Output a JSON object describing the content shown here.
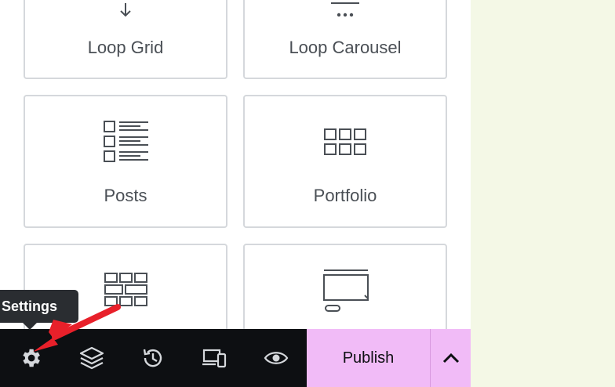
{
  "widgets": [
    {
      "label": "Loop Grid",
      "icon": "loop-grid-icon"
    },
    {
      "label": "Loop Carousel",
      "icon": "loop-carousel-icon"
    },
    {
      "label": "Posts",
      "icon": "posts-icon"
    },
    {
      "label": "Portfolio",
      "icon": "portfolio-icon"
    },
    {
      "label": "",
      "icon": "gallery-icon"
    },
    {
      "label": "",
      "icon": "slides-icon"
    }
  ],
  "tooltip": {
    "text": "Settings"
  },
  "footer": {
    "icons": [
      "gear-icon",
      "layers-icon",
      "history-icon",
      "responsive-icon",
      "preview-eye-icon"
    ],
    "publish_label": "Publish",
    "caret_icon": "chevron-up-icon"
  },
  "colors": {
    "panel_bg": "#ffffff",
    "preview_bg": "#f4f8e6",
    "footer_bg": "#0d0f12",
    "publish_bg": "#f1bbf7",
    "annotation_arrow": "#e8202a",
    "tooltip_bg": "#2a2d31"
  }
}
